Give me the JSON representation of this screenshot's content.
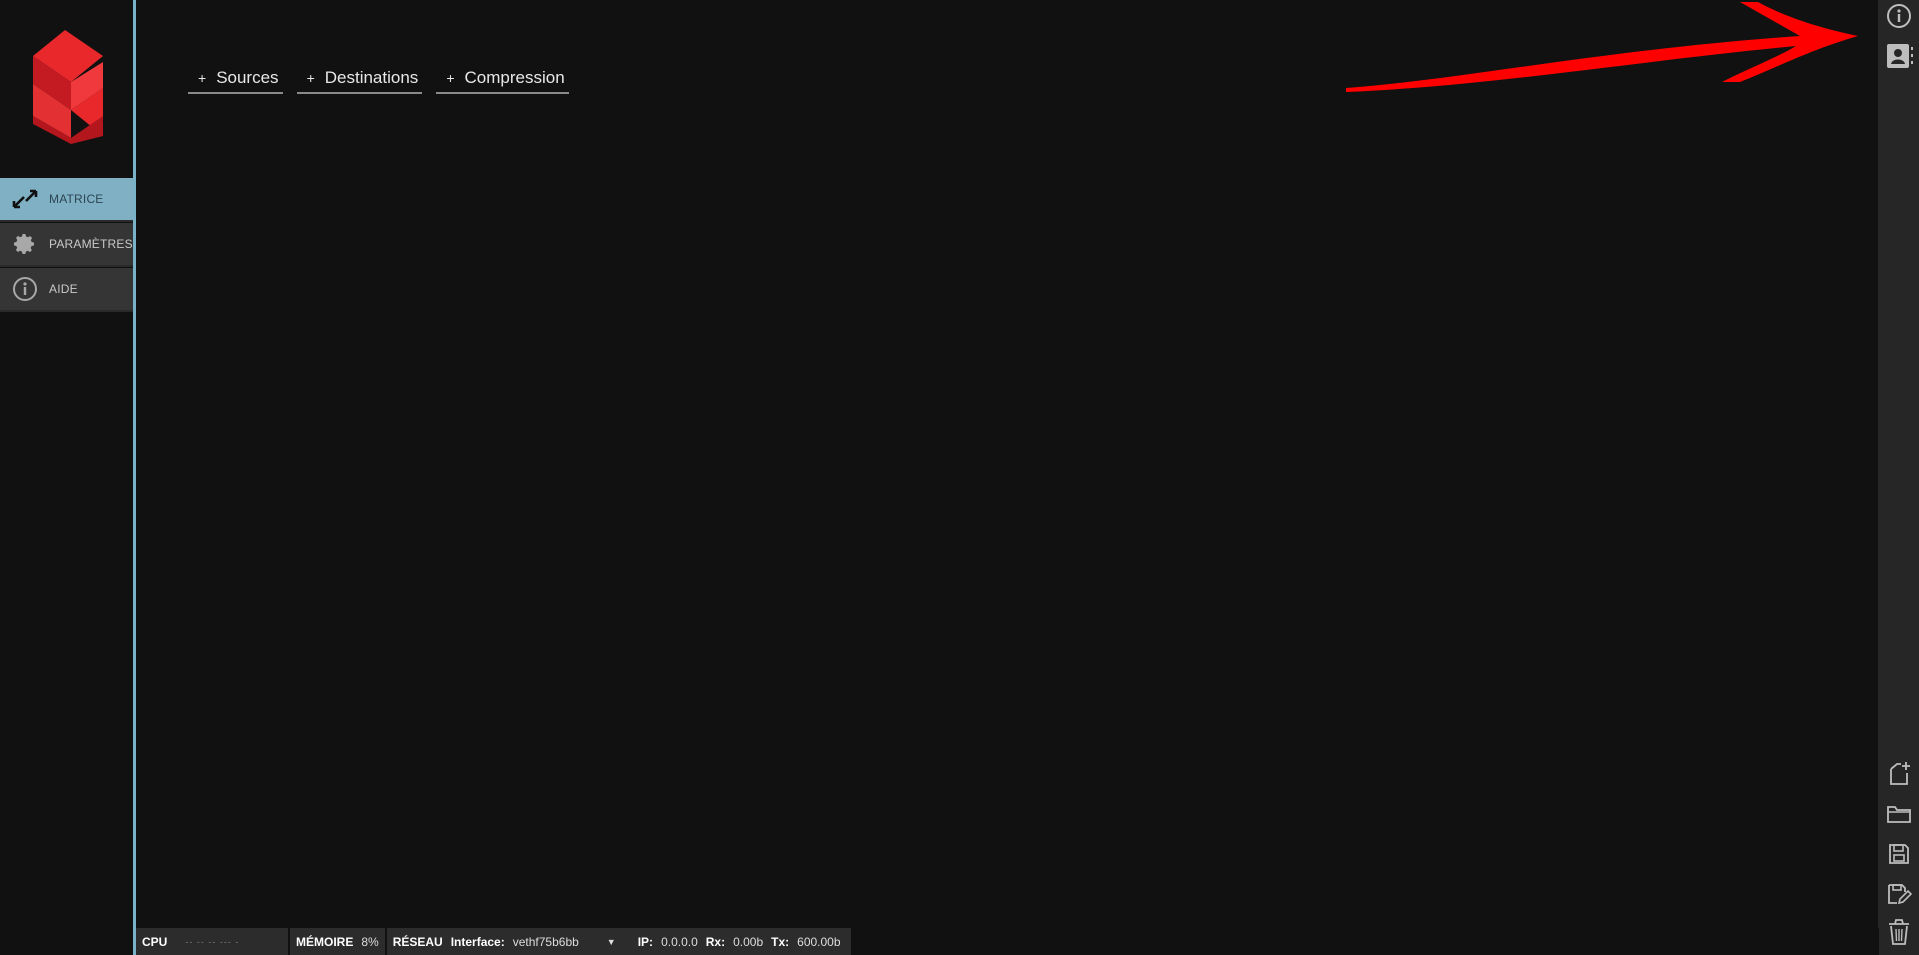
{
  "sidebar": {
    "items": [
      {
        "label": "MATRICE",
        "icon": "matrix-arrows-icon",
        "active": true
      },
      {
        "label": "PARAMÈTRES",
        "icon": "gear-icon",
        "active": false
      },
      {
        "label": "AIDE",
        "icon": "info-icon",
        "active": false
      }
    ]
  },
  "tabs": [
    {
      "plus": "+",
      "label": "Sources"
    },
    {
      "plus": "+",
      "label": "Destinations"
    },
    {
      "plus": "+",
      "label": "Compression"
    }
  ],
  "rightbar": {
    "top": [
      "info-icon",
      "user-profile-icon"
    ],
    "bottom": [
      "new-file-icon",
      "folder-icon",
      "save-icon",
      "save-as-icon",
      "trash-icon"
    ]
  },
  "status": {
    "cpu_label": "CPU",
    "cpu_value": "-- --  --  ---  -",
    "memory_label": "MÉMOIRE",
    "memory_value": "8%",
    "network_label": "RÉSEAU",
    "interface_label": "Interface:",
    "interface_value": "vethf75b6bb",
    "ip_label": "IP:",
    "ip_value": "0.0.0.0",
    "rx_label": "Rx:",
    "rx_value": "0.00b",
    "tx_label": "Tx:",
    "tx_value": "600.00b"
  },
  "colors": {
    "background": "#111111",
    "accent": "#7fb0c4",
    "logo_red": "#e8282b",
    "annotation_red": "#ff0000"
  }
}
